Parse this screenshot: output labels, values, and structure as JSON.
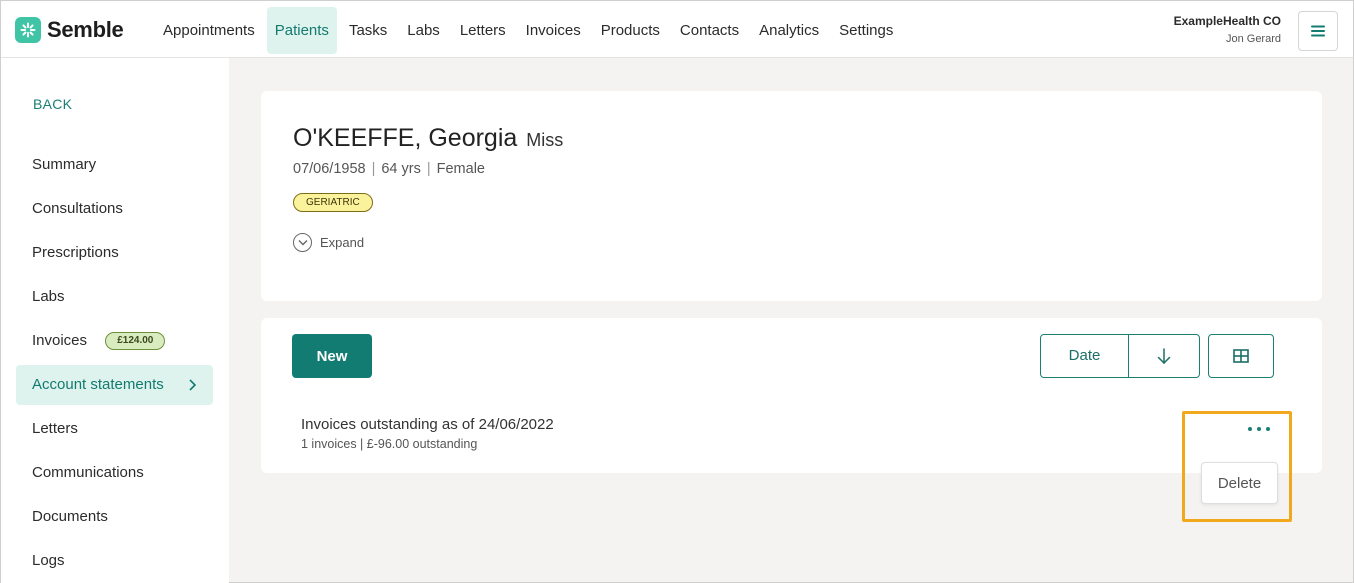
{
  "app": {
    "name": "Semble"
  },
  "nav": {
    "items": [
      {
        "label": "Appointments",
        "active": false
      },
      {
        "label": "Patients",
        "active": true
      },
      {
        "label": "Tasks",
        "active": false
      },
      {
        "label": "Labs",
        "active": false
      },
      {
        "label": "Letters",
        "active": false
      },
      {
        "label": "Invoices",
        "active": false
      },
      {
        "label": "Products",
        "active": false
      },
      {
        "label": "Contacts",
        "active": false
      },
      {
        "label": "Analytics",
        "active": false
      },
      {
        "label": "Settings",
        "active": false
      }
    ],
    "org_name": "ExampleHealth CO",
    "user_name": "Jon Gerard"
  },
  "sidebar": {
    "back_label": "BACK",
    "items": [
      {
        "label": "Summary"
      },
      {
        "label": "Consultations"
      },
      {
        "label": "Prescriptions"
      },
      {
        "label": "Labs"
      },
      {
        "label": "Invoices",
        "badge": "£124.00"
      },
      {
        "label": "Account statements",
        "active": true
      },
      {
        "label": "Letters"
      },
      {
        "label": "Communications"
      },
      {
        "label": "Documents"
      },
      {
        "label": "Logs"
      }
    ]
  },
  "patient": {
    "name": "O'KEEFFE, Georgia",
    "title": "Miss",
    "dob": "07/06/1958",
    "age": "64 yrs",
    "sex": "Female",
    "tag": "GERIATRIC",
    "expand_label": "Expand"
  },
  "statements": {
    "new_label": "New",
    "sort_label": "Date",
    "items": [
      {
        "title": "Invoices outstanding as of 24/06/2022",
        "subtitle": "1 invoices | £-96.00 outstanding"
      }
    ],
    "delete_label": "Delete"
  },
  "colors": {
    "brand": "#137c72",
    "active_bg": "#dff3ee",
    "highlight": "#f2a81d",
    "tag_bg": "#fbf29c",
    "badge_bg": "#d8ecc0"
  },
  "icons": {
    "logo": "semble-logo-icon",
    "menu": "hamburger-icon",
    "expand": "chevron-down-circle-icon",
    "sort": "arrow-down-icon",
    "grid": "grid-view-icon",
    "more": "more-dots-icon",
    "sidebar_active": "chevron-right-icon"
  }
}
